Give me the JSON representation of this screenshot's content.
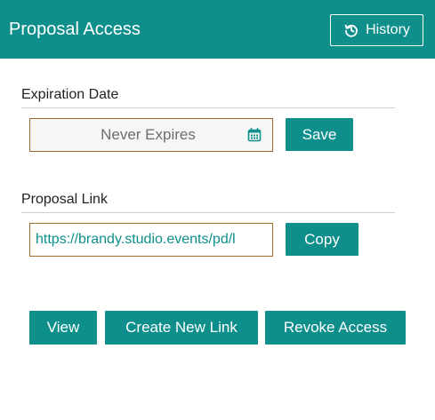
{
  "header": {
    "title": "Proposal Access",
    "history_label": "History"
  },
  "expiration": {
    "label": "Expiration Date",
    "value": "Never Expires",
    "save_label": "Save"
  },
  "proposal_link": {
    "label": "Proposal Link",
    "url": "https://brandy.studio.events/pd/l",
    "copy_label": "Copy"
  },
  "actions": {
    "view_label": "View",
    "create_new_link_label": "Create New Link",
    "revoke_access_label": "Revoke Access"
  },
  "colors": {
    "accent": "#0f8f8c",
    "input_border": "#9a6a2a"
  },
  "icons": {
    "history": "history-icon",
    "calendar": "calendar-icon"
  }
}
